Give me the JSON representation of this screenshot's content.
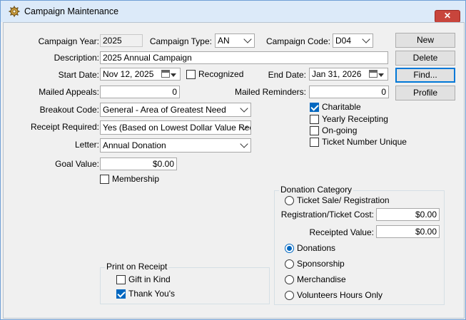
{
  "window": {
    "title": "Campaign Maintenance",
    "close_glyph": "✕"
  },
  "campaign": {
    "year_label": "Campaign Year:",
    "year_value": "2025",
    "type_label": "Campaign Type:",
    "type_value": "AN",
    "code_label": "Campaign Code:",
    "code_value": "D04",
    "description_label": "Description:",
    "description_value": "2025 Annual Campaign",
    "start_date_label": "Start Date:",
    "start_date_value": "Nov 12, 2025",
    "recognized_label": "Recognized",
    "recognized_checked": false,
    "end_date_label": "End Date:",
    "end_date_value": "Jan 31, 2026",
    "mailed_appeals_label": "Mailed Appeals:",
    "mailed_appeals_value": "0",
    "mailed_reminders_label": "Mailed Reminders:",
    "mailed_reminders_value": "0",
    "breakout_code_label": "Breakout Code:",
    "breakout_code_value": "General - Area of Greatest Need",
    "receipt_required_label": "Receipt Required:",
    "receipt_required_value": "Yes (Based on Lowest Dollar Value Rec",
    "letter_label": "Letter:",
    "letter_value": "Annual Donation",
    "goal_value_label": "Goal Value:",
    "goal_value_value": "$0.00",
    "membership_label": "Membership",
    "membership_checked": false
  },
  "options": {
    "charitable_label": "Charitable",
    "charitable_checked": true,
    "yearly_receipting_label": "Yearly Receipting",
    "yearly_receipting_checked": false,
    "ongoing_label": "On-going",
    "ongoing_checked": false,
    "ticket_unique_label": "Ticket Number Unique",
    "ticket_unique_checked": false
  },
  "buttons": {
    "new_label": "New",
    "delete_label": "Delete",
    "find_label": "Find...",
    "profile_label": "Profile"
  },
  "print_on_receipt": {
    "title": "Print on Receipt",
    "gift_in_kind_label": "Gift in Kind",
    "gift_in_kind_checked": false,
    "thank_yous_label": "Thank You's",
    "thank_yous_checked": true
  },
  "donation_category": {
    "title": "Donation Category",
    "ticket_sale_label": "Ticket Sale/ Registration",
    "registration_cost_label": "Registration/Ticket Cost:",
    "registration_cost_value": "$0.00",
    "receipted_value_label": "Receipted Value:",
    "receipted_value_value": "$0.00",
    "donations_label": "Donations",
    "sponsorship_label": "Sponsorship",
    "merchandise_label": "Merchandise",
    "volunteers_label": "Volunteers Hours Only",
    "selected": "Donations"
  },
  "colors": {
    "accent": "#0067c0",
    "close_button": "#c8453c",
    "title_bar": "#dceaf9"
  }
}
